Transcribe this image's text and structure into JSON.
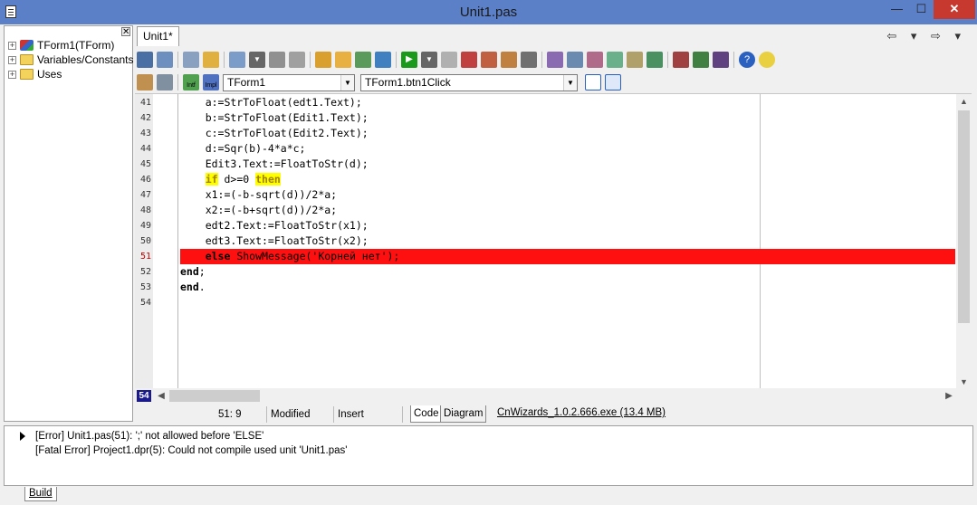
{
  "window": {
    "title": "Unit1.pas",
    "min_label": "—",
    "max_label": "☐",
    "close_label": "✕"
  },
  "tree": {
    "close_label": "✕",
    "items": [
      {
        "label": "TForm1(TForm)",
        "icon": "form-icon",
        "expander": "+"
      },
      {
        "label": "Variables/Constants",
        "icon": "folder-icon",
        "expander": "+"
      },
      {
        "label": "Uses",
        "icon": "folder-icon",
        "expander": "+"
      }
    ]
  },
  "editor_tabs": [
    {
      "label": "Unit1*"
    }
  ],
  "nav": {
    "back": "⇦ ▾ ⇨ ▾"
  },
  "toolbar2": {
    "class_combo": "TForm1",
    "method_combo": "TForm1.btn1Click",
    "intf_label": "Intf",
    "impl_label": "Impl"
  },
  "code": {
    "lines": [
      {
        "num": "41",
        "text": "    a:=StrToFloat(edt1.Text);"
      },
      {
        "num": "42",
        "text": "    b:=StrToFloat(Edit1.Text);"
      },
      {
        "num": "43",
        "text": "    c:=StrToFloat(Edit2.Text);"
      },
      {
        "num": "44",
        "text": "    d:=Sqr(b)-4*a*c;"
      },
      {
        "num": "45",
        "text": "    Edit3.Text:=FloatToStr(d);"
      },
      {
        "num": "46",
        "pre": "    ",
        "kw1": "if",
        "mid": " d>=0 ",
        "kw2": "then"
      },
      {
        "num": "47",
        "text": "    x1:=(-b-sqrt(d))/2*a;"
      },
      {
        "num": "48",
        "text": "    x2:=(-b+sqrt(d))/2*a;"
      },
      {
        "num": "49",
        "text": "    edt2.Text:=FloatToStr(x1);"
      },
      {
        "num": "50",
        "text": "    edt3.Text:=FloatToStr(x2);"
      },
      {
        "num": "51",
        "pre": "    ",
        "kw1": "else",
        "rest": " ShowMessage('Корней нет');",
        "error": true
      },
      {
        "num": "52",
        "kw1": "end",
        "rest": ";"
      },
      {
        "num": "53",
        "kw1": "end",
        "rest": "."
      },
      {
        "num": "54",
        "text": ""
      }
    ],
    "current_line_badge": "54"
  },
  "status": {
    "position": "51:  9",
    "modified": "Modified",
    "mode": "Insert",
    "tab_code": "Code",
    "tab_diagram": "Diagram",
    "cnwizards": "CnWizards_1.0.2.666.exe (13.4 MB)"
  },
  "messages": [
    "[Error] Unit1.pas(51): ';' not allowed before 'ELSE'",
    "[Fatal Error] Project1.dpr(5): Could not compile used unit 'Unit1.pas'"
  ],
  "bottom_tab": "Build",
  "colors": {
    "titlebar": "#5b80c8",
    "error_line": "#ff1010",
    "highlight": "#ffff00",
    "close_button": "#c7392f"
  }
}
